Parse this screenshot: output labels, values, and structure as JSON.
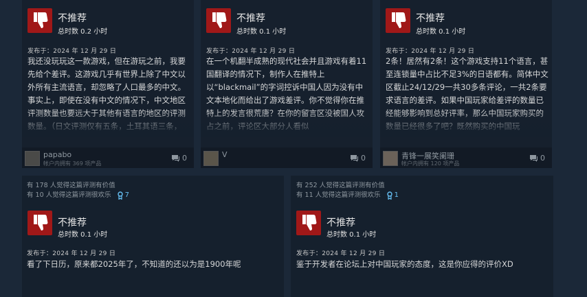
{
  "reviews_top": [
    {
      "verdict": "不推荐",
      "hours": "总时数 0.2 小时",
      "date": "发布于：2024 年 12 月 29 日",
      "text": "我还没玩玩这一款游戏，但在游玩之前，我要先给个差评。这游戏几乎有世界上除了中文以外所有主流语言，却忽略了人口最多的中文。事实上，即使在没有中文的情况下，中文地区评测数量也要远大于其他有语言的地区的评测数量。（日文评测仅有五条，土耳其语三条，",
      "user": "papabo",
      "products": "帐户内拥有 369 项产品",
      "comments": "0"
    },
    {
      "verdict": "不推荐",
      "hours": "总时数 0.1 小时",
      "date": "发布于：2024 年 12 月 29 日",
      "text": "在一个机翻半成熟的现代社会并且游戏有着11国翻译的情况下，制作人在推特上以“blackmail”的字词控诉中国人因为没有中文本地化而给出了游戏差评。你不觉得你在推特上的发言很荒唐？在你的留言区没被国人攻占之前，评论区大部分人看似",
      "user": "V",
      "products": "",
      "comments": "0"
    },
    {
      "verdict": "不推荐",
      "hours": "总时数 0.1 小时",
      "date": "发布于：2024 年 12 月 29 日",
      "text": "2条！居然有2条！这个游戏支持11个语言，甚至连锁量中占比不足3%的日语都有。简体中文区截止24/12/29一共30多条评论，一共2条要求语言的差评。如果中国玩家给差评的数量已经能够影响到总好评率，那么中国玩家购买的数量已经很多了吧？既然购买的中国玩",
      "user": "青锋一展笑阑珊",
      "products": "帐户内拥有 120 项产品",
      "comments": "0"
    }
  ],
  "reviews_bottom": [
    {
      "helpful": "有 178 人觉得这篇评测有价值",
      "funny": "有 10 人觉得这篇评测很欢乐",
      "awards": "7",
      "verdict": "不推荐",
      "hours": "总时数 0.1 小时",
      "date": "发布于：2024 年 12 月 29 日",
      "text": "看了下日历，原来都2025年了，不知道的还以为是1900年呢"
    },
    {
      "helpful": "有 252 人觉得这篇评测有价值",
      "funny": "有 11 人觉得这篇评测很欢乐",
      "awards": "1",
      "verdict": "不推荐",
      "hours": "总时数 0.1 小时",
      "date": "发布于：2024 年 12 月 29 日",
      "text": "鉴于开发者在论坛上对中国玩家的态度，这是你应得的评价XD"
    }
  ],
  "icons": {
    "verdict": "thumbs-down-icon",
    "comment": "comment-icon",
    "award": "award-icon"
  },
  "colors": {
    "page_bg": "#1b2838",
    "card_bg": "#15202d",
    "verdict_red": "#a01818",
    "award_blue": "#66c0f4"
  }
}
